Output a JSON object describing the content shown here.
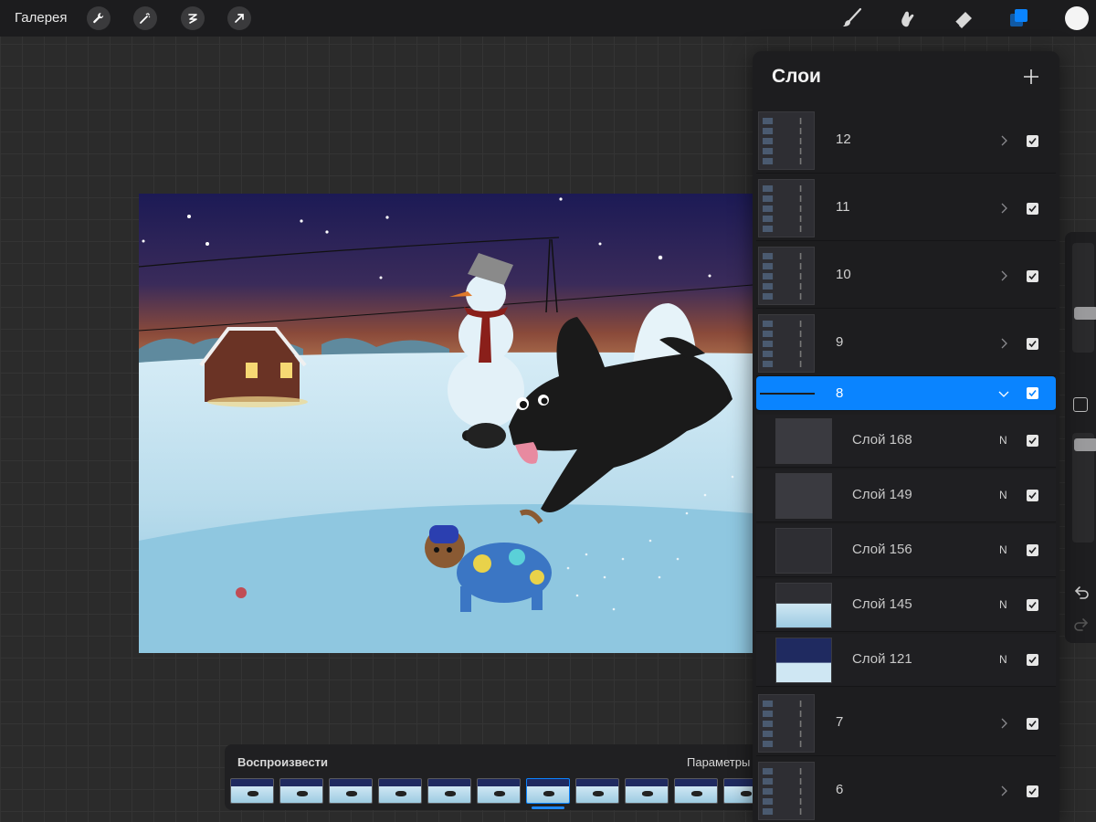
{
  "topbar": {
    "gallery_label": "Галерея",
    "left_tools": [
      {
        "name": "wrench-icon"
      },
      {
        "name": "magic-wand-icon"
      },
      {
        "name": "selection-icon"
      },
      {
        "name": "transform-arrow-icon"
      }
    ],
    "right_tools": [
      {
        "name": "brush-icon"
      },
      {
        "name": "smudge-icon"
      },
      {
        "name": "eraser-icon"
      },
      {
        "name": "layers-icon",
        "active": true
      }
    ],
    "current_color": "#f4f4f4"
  },
  "layers_panel": {
    "title": "Слои",
    "add_icon": "plus-icon",
    "groups_top": [
      {
        "name": "12",
        "expanded": false,
        "visible": true
      },
      {
        "name": "11",
        "expanded": false,
        "visible": true
      },
      {
        "name": "10",
        "expanded": false,
        "visible": true
      },
      {
        "name": "9",
        "expanded": false,
        "visible": true
      }
    ],
    "selected_group": {
      "name": "8",
      "expanded": true,
      "visible": true
    },
    "sublayers": [
      {
        "name": "Слой 168",
        "blend": "N",
        "visible": true
      },
      {
        "name": "Слой 149",
        "blend": "N",
        "visible": true
      },
      {
        "name": "Слой 156",
        "blend": "N",
        "visible": true
      },
      {
        "name": "Слой 145",
        "blend": "N",
        "visible": true
      },
      {
        "name": "Слой 121",
        "blend": "N",
        "visible": true
      }
    ],
    "groups_bottom": [
      {
        "name": "7",
        "expanded": false,
        "visible": true
      },
      {
        "name": "6",
        "expanded": false,
        "visible": true
      }
    ]
  },
  "animation": {
    "play_label": "Воспроизвести",
    "settings_label": "Параметры",
    "frame_count": 11,
    "current_frame_index": 6
  },
  "colors": {
    "accent": "#0a84ff",
    "panel": "#1d1d1f",
    "sky_top": "#1c1a55",
    "snow": "#bfe0ef"
  }
}
